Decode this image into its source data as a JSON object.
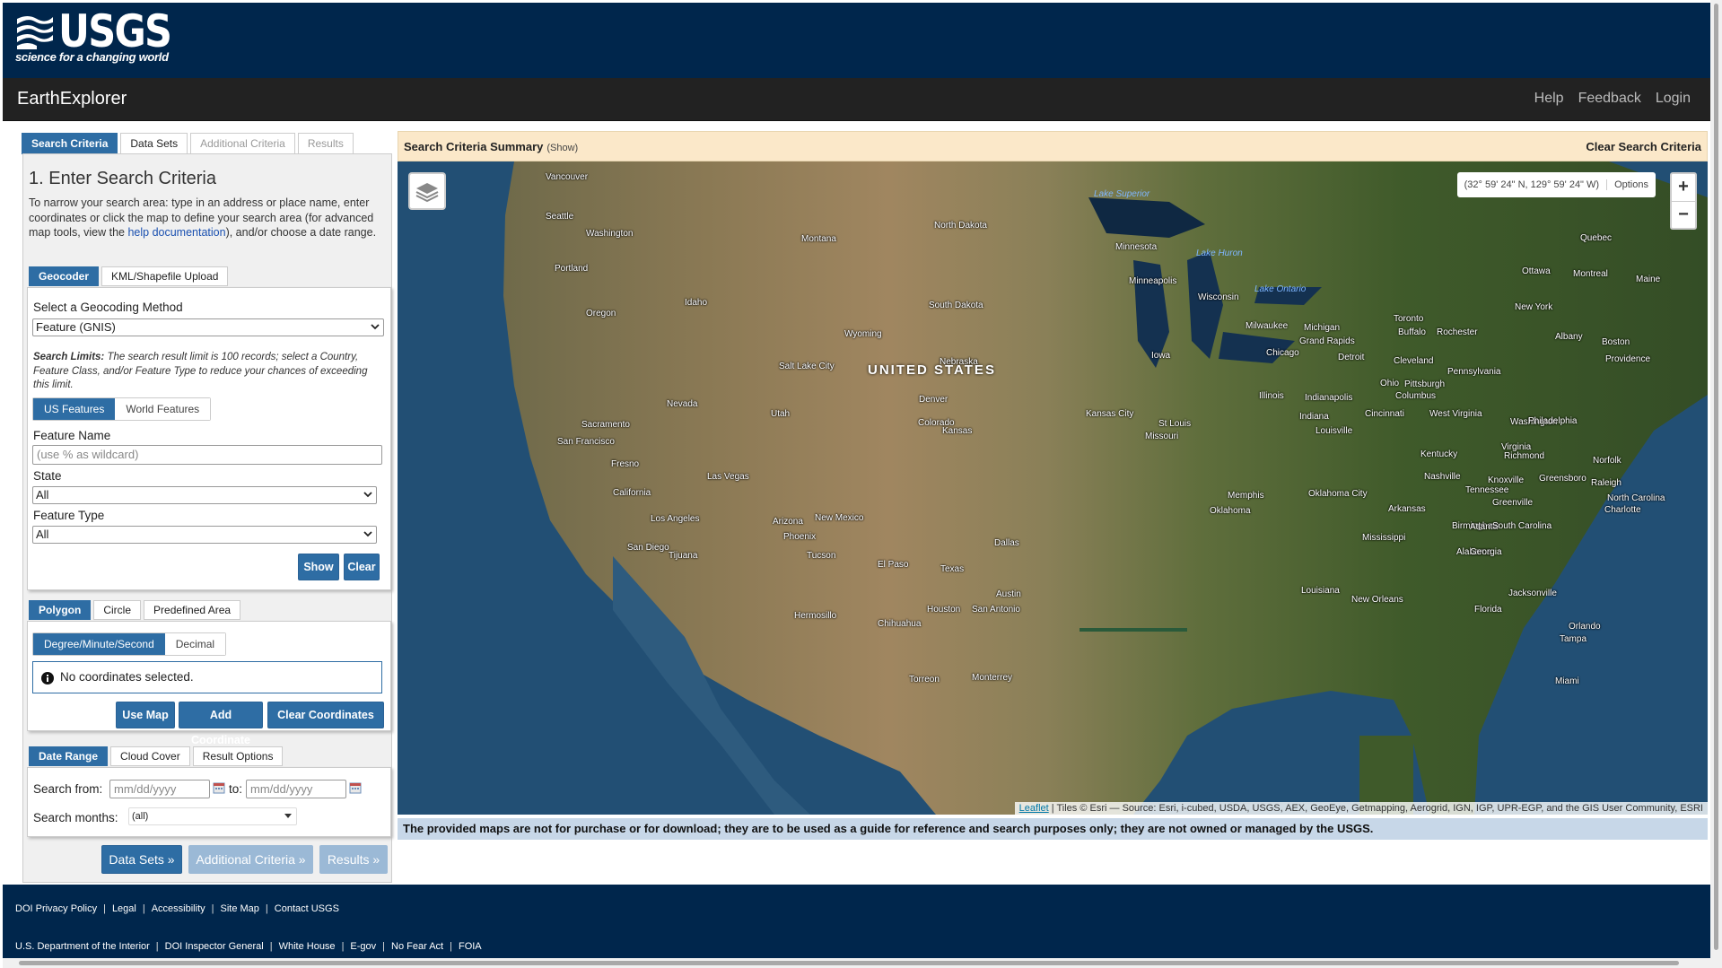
{
  "header": {
    "logo_text": "USGS",
    "tagline": "science for a changing world",
    "app_title": "EarthExplorer",
    "nav": [
      "Help",
      "Feedback",
      "Login"
    ]
  },
  "main_tabs": [
    "Search Criteria",
    "Data Sets",
    "Additional Criteria",
    "Results"
  ],
  "search": {
    "heading": "1. Enter Search Criteria",
    "intro_before": "To narrow your search area: type in an address or place name, enter coordinates or click the map to define your search area (for advanced map tools, view the ",
    "intro_link": "help documentation",
    "intro_after": "), and/or choose a date range.",
    "sub_tabs": [
      "Geocoder",
      "KML/Shapefile Upload"
    ],
    "method_label": "Select a Geocoding Method",
    "method_value": "Feature (GNIS)",
    "limits_title": "Search Limits:",
    "limits_text": " The search result limit is 100 records; select a Country, Feature Class, and/or Feature Type to reduce your chances of exceeding this limit.",
    "feature_toggle": [
      "US Features",
      "World Features"
    ],
    "feature_name_label": "Feature Name",
    "feature_name_placeholder": "(use % as wildcard)",
    "state_label": "State",
    "state_value": "All",
    "feature_type_label": "Feature Type",
    "feature_type_value": "All",
    "show_btn": "Show",
    "clear_btn": "Clear"
  },
  "area": {
    "tabs": [
      "Polygon",
      "Circle",
      "Predefined Area"
    ],
    "format_toggle": [
      "Degree/Minute/Second",
      "Decimal"
    ],
    "no_coords": "No coordinates selected.",
    "use_map": "Use Map",
    "add_coord": "Add Coordinate",
    "clear_coords": "Clear Coordinates"
  },
  "date": {
    "tabs": [
      "Date Range",
      "Cloud Cover",
      "Result Options"
    ],
    "from_label": "Search from:",
    "from_placeholder": "mm/dd/yyyy",
    "to_label": "to:",
    "to_placeholder": "mm/dd/yyyy",
    "months_label": "Search months:",
    "months_value": "(all)"
  },
  "nav_buttons": [
    "Data Sets »",
    "Additional Criteria »",
    "Results »"
  ],
  "summary": {
    "title": "Search Criteria Summary",
    "show": "(Show)",
    "clear": "Clear Search Criteria"
  },
  "map": {
    "coords_readout": "(32° 59' 24\" N, 129° 59' 24\" W)",
    "options": "Options",
    "zoom_in": "+",
    "zoom_out": "−",
    "attribution_link": "Leaflet",
    "attribution_text": " | Tiles © Esri — Source: Esri, i-cubed, USDA, USGS, AEX, GeoEye, Getmapping, Aerogrid, IGN, IGP, UPR-EGP, and the GIS User Community, ESRI",
    "country": "UNITED STATES",
    "lakes": [
      "Lake Superior",
      "Lake Huron",
      "Lake Ontario"
    ],
    "labels": [
      "Vancouver",
      "Seattle",
      "Washington",
      "Portland",
      "Oregon",
      "Idaho",
      "Montana",
      "Wyoming",
      "North Dakota",
      "South Dakota",
      "Minnesota",
      "Minneapolis",
      "Wisconsin",
      "Milwaukee",
      "Michigan",
      "Grand Rapids",
      "Chicago",
      "Detroit",
      "Toronto",
      "Buffalo",
      "Rochester",
      "Quebec",
      "Ottawa",
      "Montreal",
      "Maine",
      "New York",
      "Albany",
      "Boston",
      "Providence",
      "Cleveland",
      "Pennsylvania",
      "Pittsburgh",
      "Ohio",
      "Columbus",
      "Indianapolis",
      "Indiana",
      "Illinois",
      "Iowa",
      "Nebraska",
      "Salt Lake City",
      "Nevada",
      "Utah",
      "Denver",
      "Colorado",
      "Kansas",
      "Kansas City",
      "St Louis",
      "Missouri",
      "Louisville",
      "Cincinnati",
      "West Virginia",
      "Washington",
      "Philadelphia",
      "Virginia",
      "Richmond",
      "Norfolk",
      "Kentucky",
      "Nashville",
      "Knoxville",
      "Greensboro",
      "Raleigh",
      "North Carolina",
      "Charlotte",
      "Greenville",
      "Tennessee",
      "Memphis",
      "Arkansas",
      "Oklahoma City",
      "Oklahoma",
      "Sacramento",
      "San Francisco",
      "Fresno",
      "California",
      "Las Vegas",
      "Los Angeles",
      "San Diego",
      "Tijuana",
      "Arizona",
      "Phoenix",
      "Tucson",
      "New Mexico",
      "El Paso",
      "Texas",
      "Dallas",
      "Austin",
      "San Antonio",
      "Houston",
      "Louisiana",
      "New Orleans",
      "Mississippi",
      "Birmingham",
      "Atlanta",
      "Alabama",
      "Georgia",
      "South Carolina",
      "Jacksonville",
      "Florida",
      "Orlando",
      "Tampa",
      "Miami",
      "Hermosillo",
      "Chihuahua",
      "Torreon",
      "Monterrey"
    ]
  },
  "disclaimer": "The provided maps are not for purchase or for download; they are to be used as a guide for reference and search purposes only; they are not owned or managed by the USGS.",
  "footer": {
    "row1": [
      "DOI Privacy Policy",
      "Legal",
      "Accessibility",
      "Site Map",
      "Contact USGS"
    ],
    "row2": [
      "U.S. Department of the Interior",
      "DOI Inspector General",
      "White House",
      "E-gov",
      "No Fear Act",
      "FOIA"
    ]
  },
  "colors": {
    "header_bg": "#00264c",
    "accent": "#2e6da4",
    "summary_bg": "#fbe8c9",
    "disclaimer_bg": "#c7d7e8"
  }
}
